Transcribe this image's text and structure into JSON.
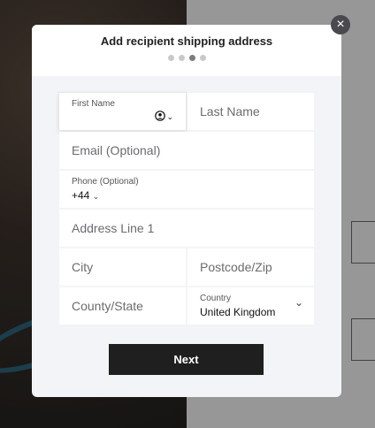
{
  "modal": {
    "title": "Add recipient shipping address",
    "step_count": 4,
    "active_step": 3
  },
  "form": {
    "first_name": {
      "label": "First Name",
      "value": ""
    },
    "last_name": {
      "placeholder": "Last Name"
    },
    "email": {
      "placeholder": "Email (Optional)"
    },
    "phone": {
      "label": "Phone (Optional)",
      "country_code": "+44"
    },
    "address_line_1": {
      "placeholder": "Address Line 1"
    },
    "city": {
      "placeholder": "City"
    },
    "postcode": {
      "placeholder": "Postcode/Zip"
    },
    "county": {
      "placeholder": "County/State"
    },
    "country": {
      "label": "Country",
      "value": "United Kingdom"
    }
  },
  "actions": {
    "next_label": "Next"
  },
  "icons": {
    "close": "close-icon",
    "contact": "person-circle-icon",
    "chevron": "chevron-down-icon"
  },
  "colors": {
    "button": "#1f1f1f",
    "modal_bg": "#f3f4f7"
  }
}
